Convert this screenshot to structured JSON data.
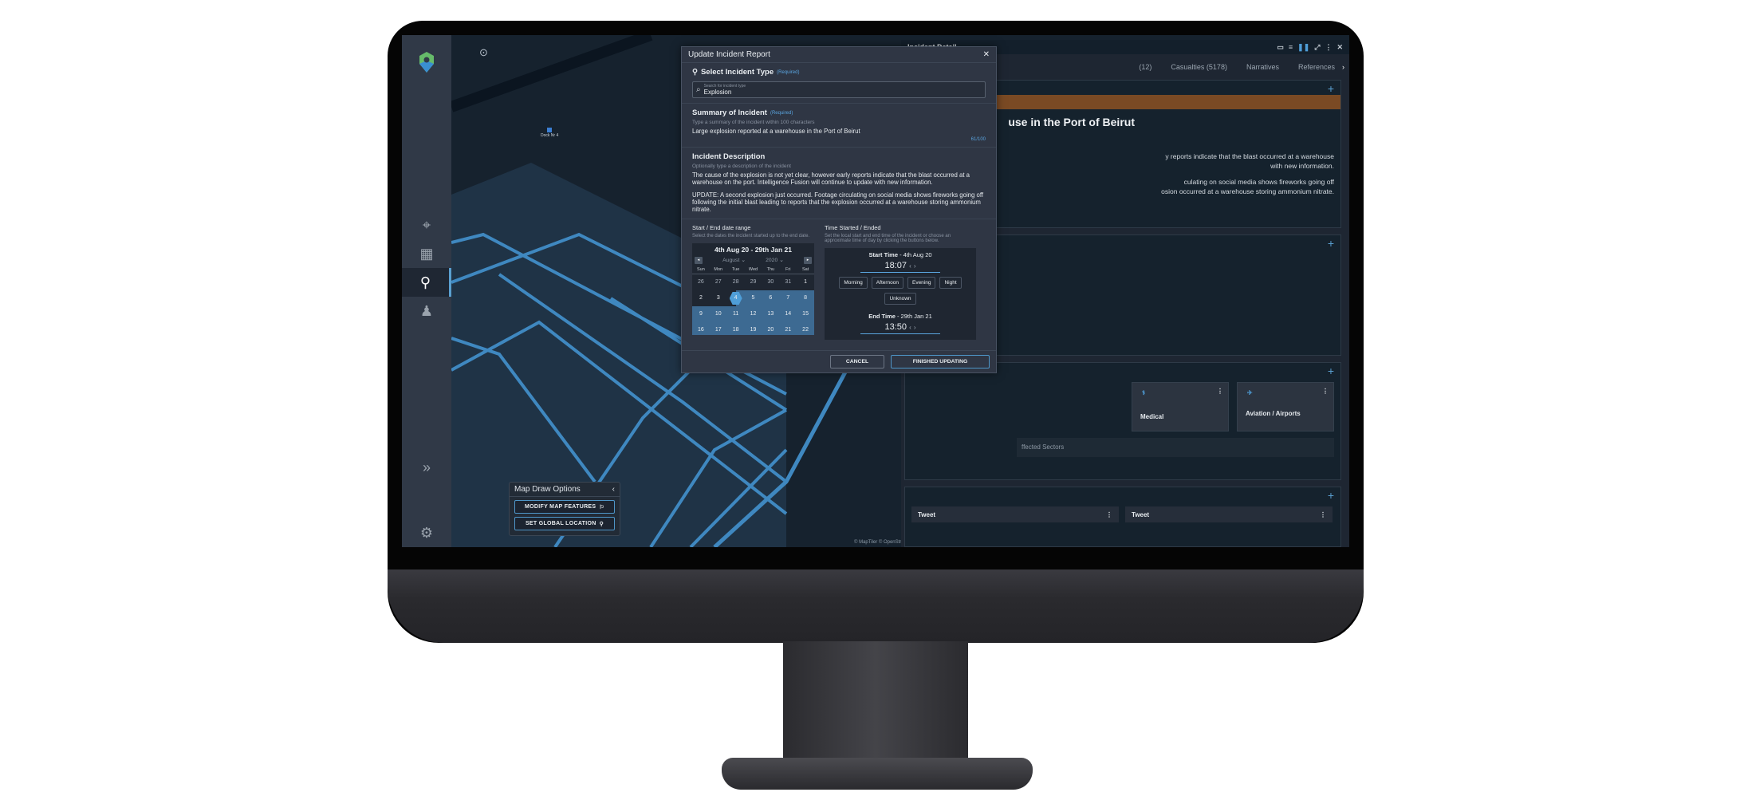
{
  "app": {
    "leftbar": {
      "items": [
        "add-location-icon",
        "layout-icon",
        "location-pin-icon",
        "user-icon"
      ],
      "expand": "»",
      "settings": "settings-icon"
    },
    "map": {
      "label": "Dock Nr 4",
      "attribution": "© MapTiler © OpenStreetMap contributors"
    },
    "draw_panel": {
      "title": "Map Draw Options",
      "buttons": [
        "MODIFY MAP FEATURES",
        "SET GLOBAL LOCATION"
      ]
    },
    "detail": {
      "title": "Incident Detail",
      "tabs": [
        "(12)",
        "Casualties (5178)",
        "Narratives",
        "References"
      ],
      "headline": "use in the Port of Beirut",
      "body_lines": [
        "y reports indicate that the blast occurred at a warehouse",
        "with new information.",
        "culating on social media shows fireworks going off",
        "osion occurred at a warehouse storing ammonium nitrate."
      ],
      "sectors": [
        "Medical",
        "Aviation / Airports"
      ],
      "affected_sectors": "ffected Sectors",
      "tweets": [
        "Tweet",
        "Tweet"
      ],
      "accent": "#7a4a24"
    },
    "dialog": {
      "title": "Update Incident Report",
      "type": {
        "heading": "Select Incident Type",
        "required": "(Required)",
        "placeholder": "Search for incident type",
        "value": "Explosion"
      },
      "summary": {
        "heading": "Summary of Incident",
        "required": "(Required)",
        "hint": "Type a summary of the incident within 100 characters",
        "value": "Large explosion reported at a warehouse in the Port of Beirut",
        "counter": "61/100"
      },
      "description": {
        "heading": "Incident Description",
        "hint": "Optionally type a description of the incident",
        "para1": "The cause of the explosion is not yet clear, however early reports indicate that the blast occurred at a warehouse on the port. Intelligence Fusion will continue to update with new information.",
        "para2": "UPDATE: A second explosion just occurred. Footage circulating on social media shows fireworks going off following the initial blast leading to reports that the explosion occurred at a warehouse storing ammonium nitrate."
      },
      "dates": {
        "heading": "Start / End date range",
        "hint": "Select the dates the incident started up to the end date.",
        "range": "4th Aug 20 - 29th Jan 21",
        "month": "August",
        "year": "2020",
        "weekdays": [
          "Sun",
          "Mon",
          "Tue",
          "Wed",
          "Thu",
          "Fri",
          "Sat"
        ],
        "days": [
          "26",
          "27",
          "28",
          "29",
          "30",
          "31",
          "1",
          "2",
          "3",
          "4",
          "5",
          "6",
          "7",
          "8",
          "9",
          "10",
          "11",
          "12",
          "13",
          "14",
          "15",
          "16",
          "17",
          "18",
          "19",
          "20",
          "21",
          "22"
        ],
        "selected_start": "4"
      },
      "times": {
        "heading": "Time Started / Ended",
        "hint": "Set the local start and end time of the incident or choose an approximate time of day by clicking the buttons below.",
        "start_label": "Start Time",
        "start_date": " - 4th Aug 20",
        "start_value": "18:07",
        "chips": [
          "Morning",
          "Afternoon",
          "Evening",
          "Night",
          "Unknown"
        ],
        "end_label": "End Time",
        "end_date": " - 29th Jan 21",
        "end_value": "13:50"
      },
      "cancel": "CANCEL",
      "finish": "FINISHED UPDATING"
    }
  }
}
